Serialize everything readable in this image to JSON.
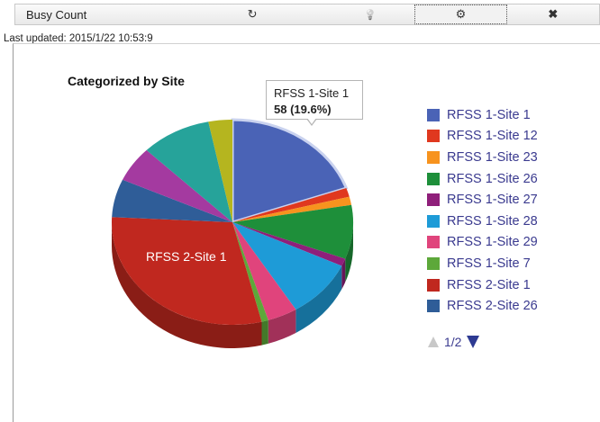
{
  "toolbar": {
    "title": "Busy Count",
    "refresh_icon": "refresh-icon",
    "bulb_icon": "lightbulb-icon",
    "gear_icon": "gear-icon",
    "close_icon": "close-icon",
    "refresh_glyph": "↻",
    "bulb_glyph": "💡",
    "gear_glyph": "⚙",
    "close_glyph": "✖"
  },
  "last_updated": "Last updated: 2015/1/22 10:53:9",
  "chart_data": {
    "type": "pie",
    "title": "Categorized by Site",
    "slices": [
      {
        "name": "RFSS 1-Site 1",
        "value": 19.6,
        "color": "#4a63b6"
      },
      {
        "name": "RFSS 1-Site 12",
        "value": 1.4,
        "color": "#e0381f"
      },
      {
        "name": "RFSS 1-Site 23",
        "value": 1.3,
        "color": "#f7931e"
      },
      {
        "name": "RFSS 1-Site 26",
        "value": 8.5,
        "color": "#1e8f3a"
      },
      {
        "name": "RFSS 1-Site 27",
        "value": 1.2,
        "color": "#8f1f7a"
      },
      {
        "name": "RFSS 1-Site 28",
        "value": 9.2,
        "color": "#1e9bd7"
      },
      {
        "name": "RFSS 1-Site 29",
        "value": 4.0,
        "color": "#e0447c"
      },
      {
        "name": "RFSS 1-Site 7",
        "value": 0.9,
        "color": "#5da83a"
      },
      {
        "name": "RFSS 2-Site 1",
        "value": 29.7,
        "color": "#c0281f"
      },
      {
        "name": "RFSS 2-Site 26",
        "value": 6.0,
        "color": "#2f5d98"
      },
      {
        "name": "",
        "value": 5.6,
        "color": "#a43aa0"
      },
      {
        "name": "",
        "value": 9.4,
        "color": "#26a39a"
      },
      {
        "name": "",
        "value": 3.2,
        "color": "#b5b51f"
      }
    ],
    "tooltip": {
      "name": "RFSS 1-Site 1",
      "value": "58 (19.6%)"
    },
    "slice_label": "RFSS 2-Site 1",
    "legend": [
      {
        "name": "RFSS 1-Site 1",
        "color": "#4a63b6"
      },
      {
        "name": "RFSS 1-Site 12",
        "color": "#e0381f"
      },
      {
        "name": "RFSS 1-Site 23",
        "color": "#f7931e"
      },
      {
        "name": "RFSS 1-Site 26",
        "color": "#1e8f3a"
      },
      {
        "name": "RFSS 1-Site 27",
        "color": "#8f1f7a"
      },
      {
        "name": "RFSS 1-Site 28",
        "color": "#1e9bd7"
      },
      {
        "name": "RFSS 1-Site 29",
        "color": "#e0447c"
      },
      {
        "name": "RFSS 1-Site 7",
        "color": "#5da83a"
      },
      {
        "name": "RFSS 2-Site 1",
        "color": "#c0281f"
      },
      {
        "name": "RFSS 2-Site 26",
        "color": "#2f5d98"
      }
    ],
    "legend_placement": "right",
    "pager": "1/2"
  }
}
